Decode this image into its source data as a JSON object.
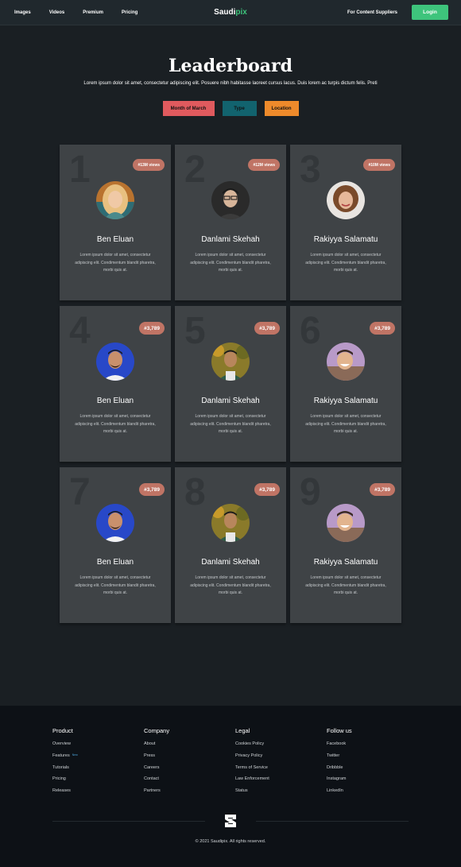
{
  "nav": {
    "links": [
      "Images",
      "Videos",
      "Premium",
      "Pricing"
    ],
    "brand_main": "Saudi",
    "brand_accent": "pix",
    "suppliers": "For Content Suppliers",
    "login": "Login"
  },
  "header": {
    "title": "Leaderboard",
    "subtitle": "Lorem ipsum dolor sit amet, consectetur adipiscing elit. Posuere nibh habitasse laoreet cursus lacus. Duis lorem ac turpis dictum felis. Preti"
  },
  "filters": [
    "Month of March",
    "Type",
    "Location"
  ],
  "cards": [
    {
      "rank": "1",
      "badge": "#13M views",
      "name": "Ben Eluan",
      "avatar": "avatar-woman-blonde"
    },
    {
      "rank": "2",
      "badge": "#12M views",
      "name": "Danlami Skehah",
      "avatar": "avatar-man-glasses"
    },
    {
      "rank": "3",
      "badge": "#10M views",
      "name": "Rakiyya Salamatu",
      "avatar": "avatar-woman-curly"
    },
    {
      "rank": "4",
      "badge": "#3,789",
      "name": "Ben Eluan",
      "avatar": "avatar-man-blue"
    },
    {
      "rank": "5",
      "badge": "#3,789",
      "name": "Danlami Skehah",
      "avatar": "avatar-man-autumn"
    },
    {
      "rank": "6",
      "badge": "#3,789",
      "name": "Rakiyya Salamatu",
      "avatar": "avatar-man-smile"
    },
    {
      "rank": "7",
      "badge": "#3,789",
      "name": "Ben Eluan",
      "avatar": "avatar-man-blue"
    },
    {
      "rank": "8",
      "badge": "#3,789",
      "name": "Danlami Skehah",
      "avatar": "avatar-man-autumn"
    },
    {
      "rank": "9",
      "badge": "#3,789",
      "name": "Rakiyya Salamatu",
      "avatar": "avatar-man-smile"
    }
  ],
  "card_desc": "Lorem ipsum dolor sit amet, consectetur adipiscing elit. Condimentum blandit pharetra, morbi quis at.",
  "footer": {
    "columns": [
      {
        "heading": "Product",
        "items": [
          "Overview",
          "Features",
          "Tutorials",
          "Pricing",
          "Releases"
        ]
      },
      {
        "heading": "Company",
        "items": [
          "About",
          "Press",
          "Careers",
          "Contact",
          "Partners"
        ]
      },
      {
        "heading": "Legal",
        "items": [
          "Cookies Policy",
          "Privacy Policy",
          "Terms of Service",
          "Law Enforcement",
          "Status"
        ]
      },
      {
        "heading": "Follow us",
        "items": [
          "Facebook",
          "Twitter",
          "Dribbble",
          "Instagram",
          "LinkedIn"
        ]
      }
    ],
    "new_tag": "New",
    "copyright": "© 2021 Saudipix. All rights reserved."
  },
  "colors": {
    "accent": "#3ec47c",
    "badge": "#c07465",
    "filter_month": "#e05a5e",
    "filter_type": "#12636e",
    "filter_location": "#ee8a2b"
  }
}
